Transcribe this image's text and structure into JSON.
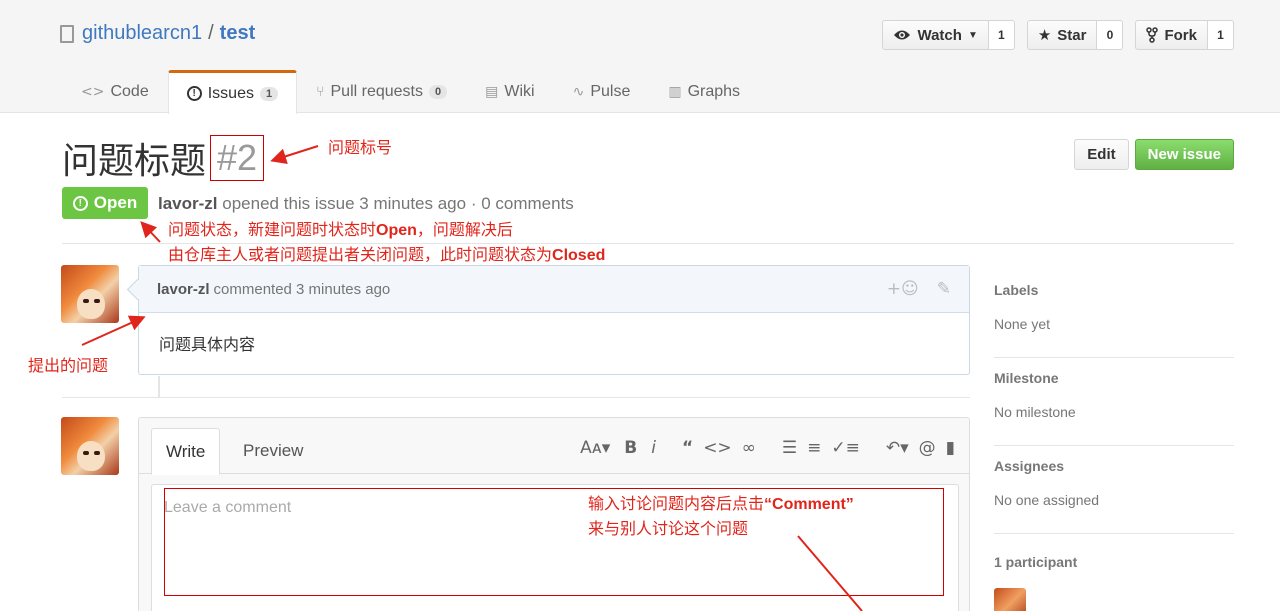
{
  "repo": {
    "owner": "githublearcn1",
    "separator": "/",
    "name": "test"
  },
  "actions": [
    {
      "label": "Watch",
      "icon": "eye-icon",
      "count": "1"
    },
    {
      "label": "Star",
      "icon": "star-icon",
      "count": "0"
    },
    {
      "label": "Fork",
      "icon": "fork-icon",
      "count": "1"
    }
  ],
  "nav": {
    "code": "Code",
    "issues": "Issues",
    "issues_count": "1",
    "pulls": "Pull requests",
    "pulls_count": "0",
    "wiki": "Wiki",
    "pulse": "Pulse",
    "graphs": "Graphs"
  },
  "issue": {
    "title": "问题标题",
    "number": "#2",
    "state": "Open",
    "author": "lavor-zl",
    "meta_text": "opened this issue 3 minutes ago · 0 comments",
    "edit_label": "Edit",
    "new_issue_label": "New issue"
  },
  "comment": {
    "author": "lavor-zl",
    "meta": "commented 3 minutes ago",
    "body": "问题具体内容",
    "add_reaction": "+☺"
  },
  "new_comment": {
    "write_tab": "Write",
    "preview_tab": "Preview",
    "placeholder": "Leave a comment"
  },
  "sidebar": {
    "labels_head": "Labels",
    "labels_val": "None yet",
    "milestone_head": "Milestone",
    "milestone_val": "No milestone",
    "assignees_head": "Assignees",
    "assignees_val": "No one assigned",
    "participants_head": "1 participant"
  },
  "annotations": {
    "num": "问题标号",
    "state_line1_a": "问题状态，新建问题时状态时",
    "state_line1_b": "Open",
    "state_line1_c": "，问题解决后",
    "state_line2_a": "由仓库主人或者问题提出者关闭问题，此时问题状态为",
    "state_line2_b": "Closed",
    "question": "提出的问题",
    "box_line1_a": "输入讨论问题内容后点击",
    "box_line1_b": "“Comment”",
    "box_line2": "来与别人讨论这个问题"
  },
  "colors": {
    "accent": "#4078c0",
    "open_green": "#6cc644",
    "annotation_red": "#e0251b",
    "tab_orange": "#d26911"
  }
}
